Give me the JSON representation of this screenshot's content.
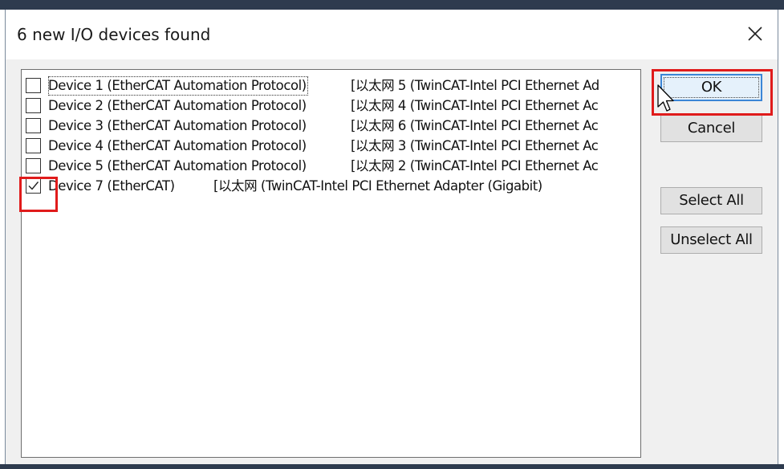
{
  "dialog": {
    "title": "6 new I/O devices found",
    "close_symbol": "✕"
  },
  "devices": [
    {
      "name": "Device 1 (EtherCAT Automation Protocol)",
      "adapter": "[以太网 5 (TwinCAT-Intel PCI Ethernet Ad",
      "checked": false
    },
    {
      "name": "Device 2 (EtherCAT Automation Protocol)",
      "adapter": "[以太网 4 (TwinCAT-Intel PCI Ethernet Ac",
      "checked": false
    },
    {
      "name": "Device 3 (EtherCAT Automation Protocol)",
      "adapter": "[以太网 6 (TwinCAT-Intel PCI Ethernet Ac",
      "checked": false
    },
    {
      "name": "Device 4 (EtherCAT Automation Protocol)",
      "adapter": "[以太网 3 (TwinCAT-Intel PCI Ethernet Ac",
      "checked": false
    },
    {
      "name": "Device 5 (EtherCAT Automation Protocol)",
      "adapter": "[以太网 2 (TwinCAT-Intel PCI Ethernet Ac",
      "checked": false
    },
    {
      "name": "Device 7 (EtherCAT)",
      "adapter": "[以太网 (TwinCAT-Intel PCI Ethernet Adapter (Gigabit)",
      "checked": true
    }
  ],
  "buttons": {
    "ok": "OK",
    "cancel": "Cancel",
    "select_all": "Select All",
    "unselect_all": "Unselect All"
  },
  "colors": {
    "highlight": "#e01b1b",
    "default_button_border": "#3c86d6"
  }
}
